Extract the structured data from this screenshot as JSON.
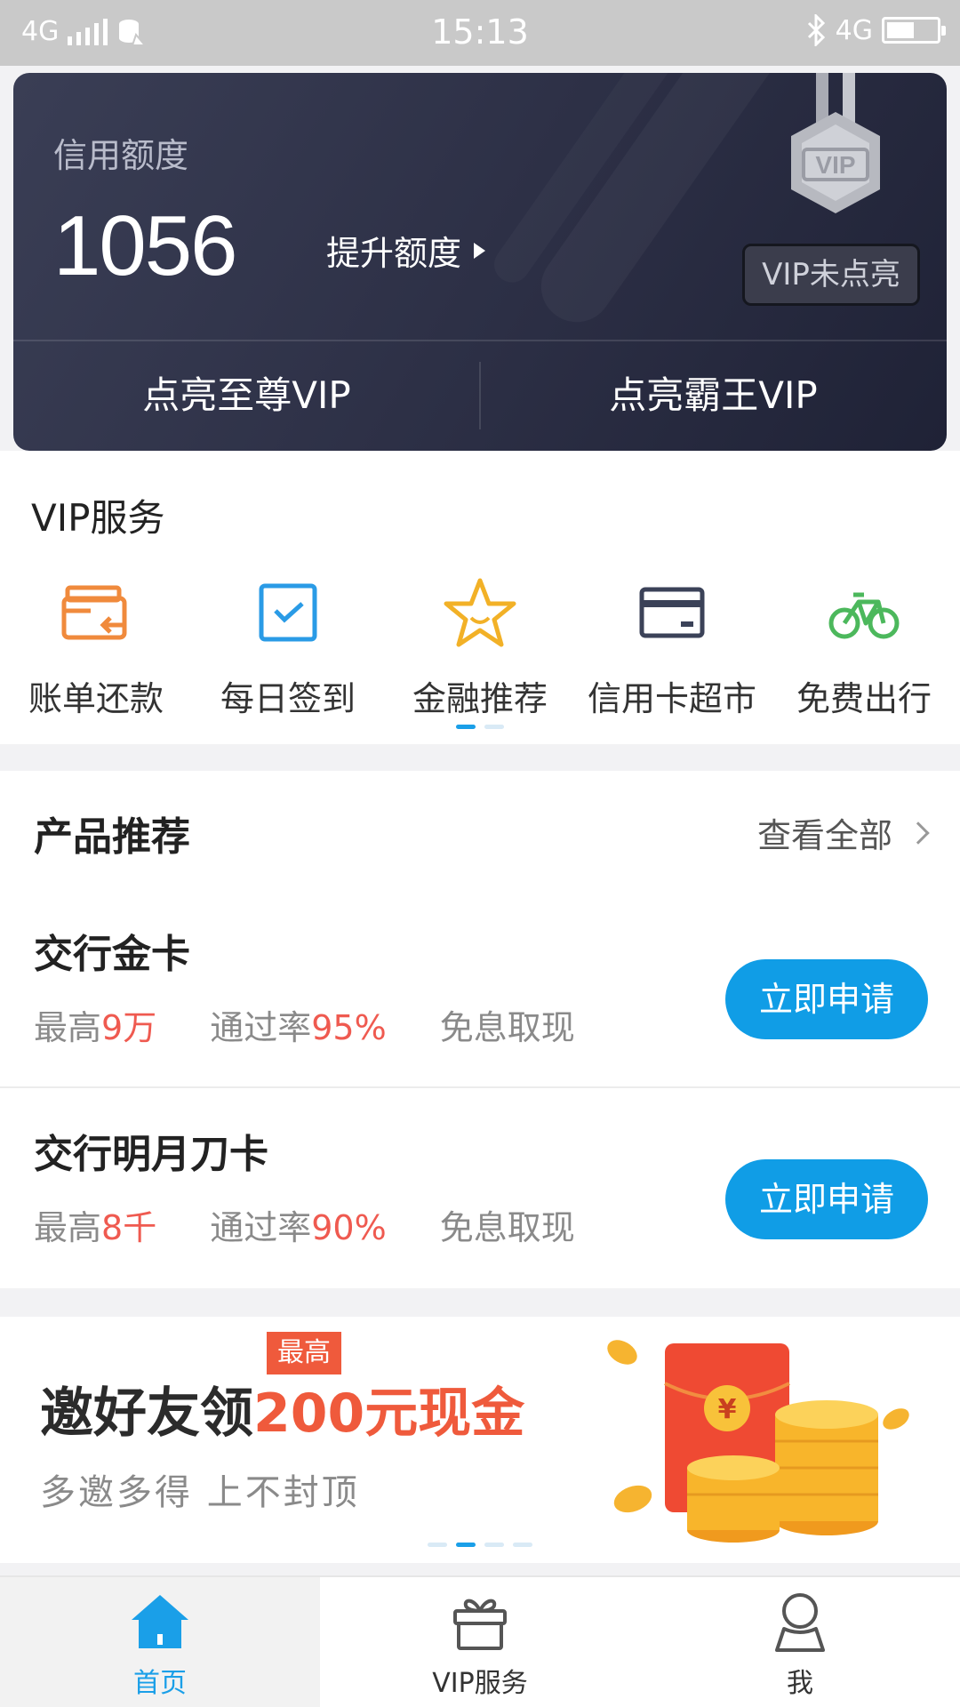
{
  "status_bar": {
    "network_left": "4G",
    "time": "15:13",
    "network_right": "4G",
    "battery_level": 0.55
  },
  "credit_card": {
    "label": "信用额度",
    "amount": "1056",
    "raise_label": "提升额度",
    "vip_badge_text": "VIP",
    "vip_status": "VIP未点亮",
    "buttons": [
      "点亮至尊VIP",
      "点亮霸王VIP"
    ]
  },
  "vip_services": {
    "title": "VIP服务",
    "items": [
      {
        "label": "账单还款",
        "icon": "bill-repay-icon",
        "color": "#f08a3c"
      },
      {
        "label": "每日签到",
        "icon": "checkin-icon",
        "color": "#2a9be6"
      },
      {
        "label": "金融推荐",
        "icon": "star-icon",
        "color": "#f2b127"
      },
      {
        "label": "信用卡超市",
        "icon": "credit-card-icon",
        "color": "#3b4258"
      },
      {
        "label": "免费出行",
        "icon": "bicycle-icon",
        "color": "#4cb85c"
      }
    ],
    "page_count": 2,
    "page_active": 0
  },
  "products": {
    "title": "产品推荐",
    "view_all": "查看全部",
    "items": [
      {
        "name": "交行金卡",
        "limit_prefix": "最高",
        "limit_value": "9万",
        "rate_prefix": "通过率",
        "rate_value": "95%",
        "feature": "免息取现",
        "apply_label": "立即申请"
      },
      {
        "name": "交行明月刀卡",
        "limit_prefix": "最高",
        "limit_value": "8千",
        "rate_prefix": "通过率",
        "rate_value": "90%",
        "feature": "免息取现",
        "apply_label": "立即申请"
      }
    ]
  },
  "banner": {
    "title_main": "邀好友领",
    "title_highlight": "200元现金",
    "tag": "最高",
    "subtitle": "多邀多得  上不封顶",
    "currency_symbol": "¥",
    "page_count": 4,
    "page_active": 1
  },
  "tabbar": {
    "tabs": [
      {
        "label": "首页",
        "icon": "home-icon",
        "active": true
      },
      {
        "label": "VIP服务",
        "icon": "gift-icon",
        "active": false
      },
      {
        "label": "我",
        "icon": "user-icon",
        "active": false
      }
    ]
  },
  "colors": {
    "accent": "#109de6",
    "highlight_red": "#ef5a50",
    "card_dark": "#2c2f45"
  }
}
